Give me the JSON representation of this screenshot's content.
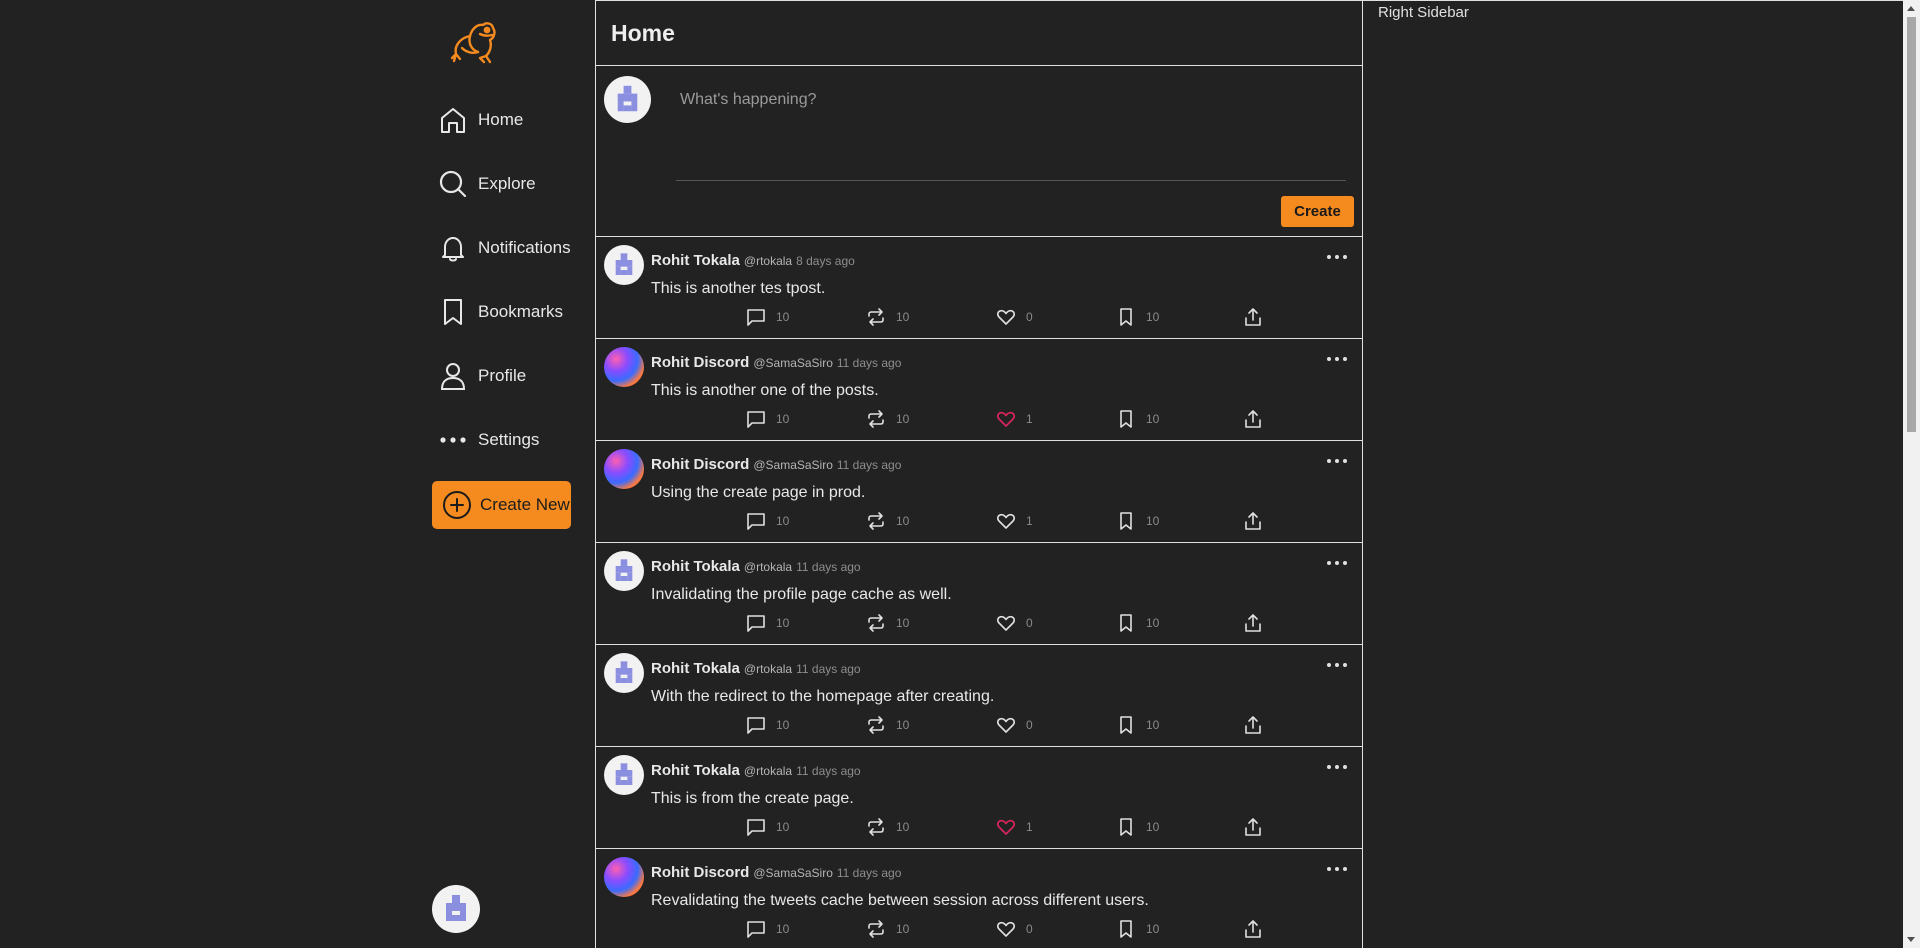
{
  "nav": {
    "items": [
      {
        "label": "Home",
        "icon": "home-icon"
      },
      {
        "label": "Explore",
        "icon": "search-icon"
      },
      {
        "label": "Notifications",
        "icon": "bell-icon"
      },
      {
        "label": "Bookmarks",
        "icon": "bookmark-icon"
      },
      {
        "label": "Profile",
        "icon": "user-icon"
      },
      {
        "label": "Settings",
        "icon": "more-dots-icon"
      }
    ],
    "create_new_label": "Create New"
  },
  "header": {
    "title": "Home"
  },
  "composer": {
    "placeholder": "What's happening?",
    "create_label": "Create"
  },
  "posts": [
    {
      "name": "Rohit Tokala",
      "handle": "@rtokala",
      "time": "8 days ago",
      "text": "This is another tes tpost.",
      "comments": "10",
      "retweets": "10",
      "likes": "0",
      "liked": false,
      "bookmarks": "10",
      "avatar": "default"
    },
    {
      "name": "Rohit Discord",
      "handle": "@SamaSaSiro",
      "time": "11 days ago",
      "text": "This is another one of the posts.",
      "comments": "10",
      "retweets": "10",
      "likes": "1",
      "liked": true,
      "bookmarks": "10",
      "avatar": "discord"
    },
    {
      "name": "Rohit Discord",
      "handle": "@SamaSaSiro",
      "time": "11 days ago",
      "text": "Using the create page in prod.",
      "comments": "10",
      "retweets": "10",
      "likes": "1",
      "liked": false,
      "bookmarks": "10",
      "avatar": "discord"
    },
    {
      "name": "Rohit Tokala",
      "handle": "@rtokala",
      "time": "11 days ago",
      "text": "Invalidating the profile page cache as well.",
      "comments": "10",
      "retweets": "10",
      "likes": "0",
      "liked": false,
      "bookmarks": "10",
      "avatar": "default"
    },
    {
      "name": "Rohit Tokala",
      "handle": "@rtokala",
      "time": "11 days ago",
      "text": "With the redirect to the homepage after creating.",
      "comments": "10",
      "retweets": "10",
      "likes": "0",
      "liked": false,
      "bookmarks": "10",
      "avatar": "default"
    },
    {
      "name": "Rohit Tokala",
      "handle": "@rtokala",
      "time": "11 days ago",
      "text": "This is from the create page.",
      "comments": "10",
      "retweets": "10",
      "likes": "1",
      "liked": true,
      "bookmarks": "10",
      "avatar": "default"
    },
    {
      "name": "Rohit Discord",
      "handle": "@SamaSaSiro",
      "time": "11 days ago",
      "text": "Revalidating the tweets cache between session across different users.",
      "comments": "10",
      "retweets": "10",
      "likes": "0",
      "liked": false,
      "bookmarks": "10",
      "avatar": "discord"
    }
  ],
  "right_sidebar": {
    "label": "Right Sidebar"
  },
  "colors": {
    "accent": "#f58a1f",
    "liked": "#e0245e",
    "background": "#222222",
    "border": "#e0e0e0"
  }
}
